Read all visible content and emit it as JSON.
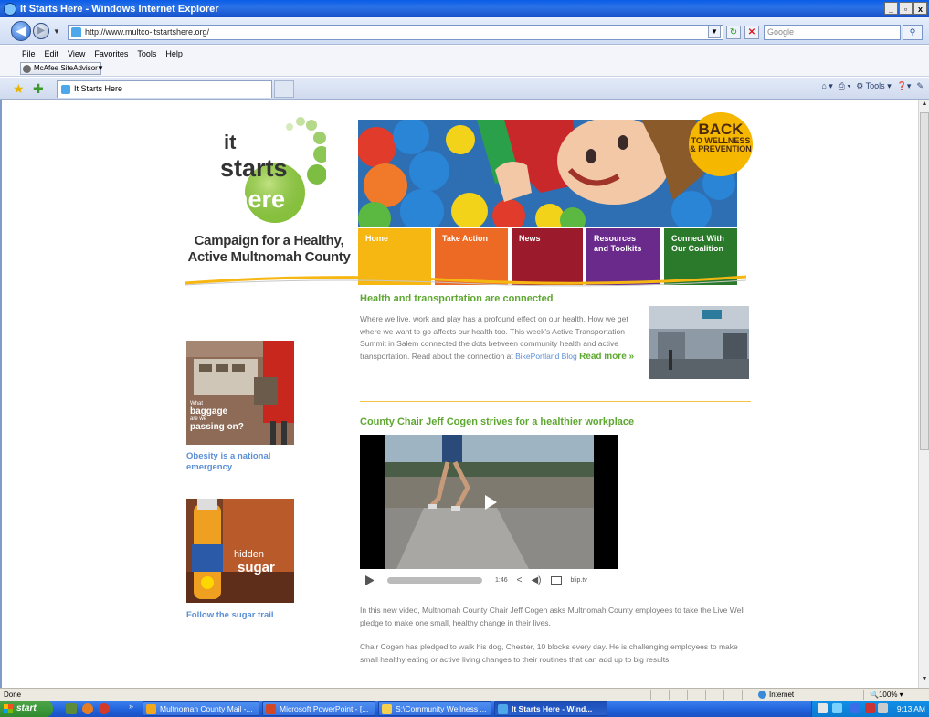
{
  "window": {
    "title": "It Starts Here - Windows Internet Explorer",
    "controls": [
      "_",
      "▫",
      "x"
    ]
  },
  "address_bar": {
    "url": "http://www.multco-itstartshere.org/",
    "search_placeholder": "Google"
  },
  "menu": [
    "File",
    "Edit",
    "View",
    "Favorites",
    "Tools",
    "Help"
  ],
  "toolbar": {
    "mcafee_label": "McAfee SiteAdvisor",
    "tab_title": "It Starts Here",
    "commands": [
      "Tools"
    ]
  },
  "page": {
    "logo": {
      "line1": "it",
      "line2": "starts",
      "line3": "here"
    },
    "tagline_line1": "Campaign for a Healthy,",
    "tagline_line2": "Active Multnomah County",
    "badge": {
      "line1": "BACK",
      "line2": "TO WELLNESS",
      "line3": "& PREVENTION"
    },
    "nav": [
      {
        "label": "Home",
        "color": "#f6b713"
      },
      {
        "label": "Take Action",
        "color": "#ec6a23"
      },
      {
        "label": "News",
        "color": "#9b1b2c"
      },
      {
        "label": "Resources",
        "label2": "and Toolkits",
        "color": "#6a2a8c"
      },
      {
        "label": "Connect With",
        "label2": "Our Coalition",
        "color": "#2b7a2b"
      }
    ],
    "article1": {
      "title": "Health and transportation are connected",
      "body": "Where we live, work and play has a profound effect on our health. How we get where we want to go affects our health too. This week's Active Transportation Summit in Salem connected the dots between community health and active transportation. Read about the connection at ",
      "link": "BikePortland Blog",
      "read_more": "Read more »"
    },
    "article2": {
      "title": "County Chair Jeff Cogen strives for a healthier workplace",
      "video_duration": "1:46",
      "video_source": "blip.tv",
      "para1": "In this new video, Multnomah County Chair Jeff Cogen asks Multnomah County employees to take the Live Well pledge to make one small, healthy change in their lives.",
      "para2": "Chair Cogen has pledged to walk his dog, Chester, 10 blocks every day. He is challenging employees to make small healthy eating or active living changes to their routines that can add up to big results."
    },
    "sidebar": {
      "promo1_caption_small1": "What",
      "promo1_caption_big1": "baggage",
      "promo1_caption_small2": "are we",
      "promo1_caption_big2": "passing on?",
      "promo1_link": "Obesity is a national emergency",
      "promo2_caption1": "hidden",
      "promo2_caption2": "sugar",
      "promo2_link": "Follow the sugar trail"
    }
  },
  "status_bar": {
    "text": "Done",
    "zone": "Internet",
    "zoom": "100%"
  },
  "taskbar": {
    "start": "start",
    "tasks": [
      {
        "label": "Multnomah County Mail -...",
        "icon_color": "#f2a81d"
      },
      {
        "label": "Microsoft PowerPoint - [...",
        "icon_color": "#d24726"
      },
      {
        "label": "S:\\Community Wellness ...",
        "icon_color": "#f5cf50"
      },
      {
        "label": "It Starts Here - Wind...",
        "icon_color": "#4da7e8",
        "active": true
      }
    ],
    "clock": "9:13 AM"
  }
}
